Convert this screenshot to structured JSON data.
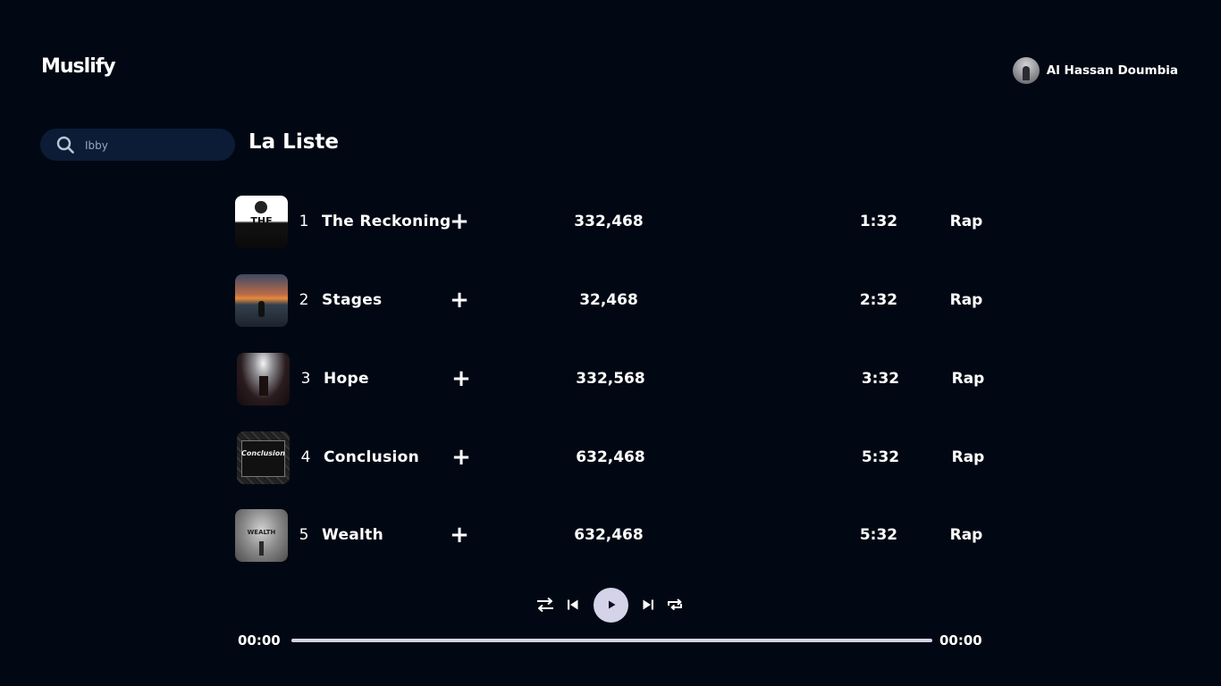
{
  "app": {
    "logo": "Muslify"
  },
  "user": {
    "name": "Al Hassan Doumbia"
  },
  "search": {
    "value": "Ibby",
    "icon": "search-icon"
  },
  "playlist": {
    "title": "La Liste",
    "tracks": [
      {
        "number": "1",
        "name": "The Reckoning",
        "plays": "332,468",
        "duration": "1:32",
        "genre": "Rap",
        "cover_text": "THE RECKONING"
      },
      {
        "number": "2",
        "name": "Stages",
        "plays": "32,468",
        "duration": "2:32",
        "genre": "Rap",
        "cover_text": ""
      },
      {
        "number": "3",
        "name": "Hope",
        "plays": "332,568",
        "duration": "3:32",
        "genre": "Rap",
        "cover_text": ""
      },
      {
        "number": "4",
        "name": "Conclusion",
        "plays": "632,468",
        "duration": "5:32",
        "genre": "Rap",
        "cover_text": "Conclusion"
      },
      {
        "number": "5",
        "name": "Wealth",
        "plays": "632,468",
        "duration": "5:32",
        "genre": "Rap",
        "cover_text": "WEALTH"
      }
    ],
    "add_symbol": "+"
  },
  "player": {
    "current_time": "00:00",
    "total_time": "00:00",
    "progress": 1.0,
    "colors": {
      "play_button": "#d5d3ea",
      "progress": "#d3d3e8",
      "background": "#020813",
      "search_bg": "#0c1c36"
    }
  }
}
